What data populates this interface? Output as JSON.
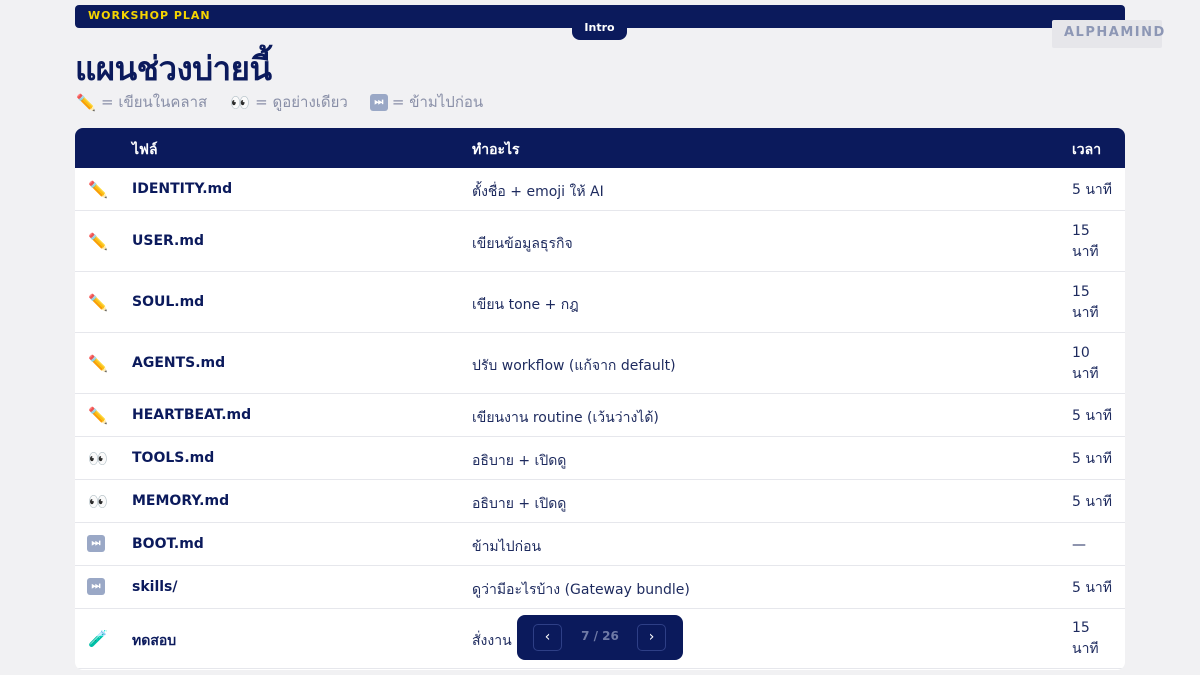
{
  "header": {
    "section_label": "WORKSHOP PLAN",
    "intro_tab": "Intro",
    "logo_text": "ALPHAMIND"
  },
  "title": "แผนช่วงบ่ายนี้",
  "legend": [
    {
      "icon": "pencil-icon",
      "glyph": "✏️",
      "text": "= เขียนในคลาส"
    },
    {
      "icon": "eyes-icon",
      "glyph": "👀",
      "text": "= ดูอย่างเดียว"
    },
    {
      "icon": "skip-icon",
      "glyph": "⏭",
      "text": "= ข้ามไปก่อน"
    }
  ],
  "table": {
    "headers": {
      "file": "ไฟล์",
      "what": "ทำอะไร",
      "time": "เวลา"
    },
    "rows": [
      {
        "icon": "pencil-icon",
        "file": "IDENTITY.md",
        "what": "ตั้งชื่อ + emoji ให้ AI",
        "time": "5 นาที"
      },
      {
        "icon": "pencil-icon",
        "file": "USER.md",
        "what": "เขียนข้อมูลธุรกิจ",
        "time": "15 นาที"
      },
      {
        "icon": "pencil-icon",
        "file": "SOUL.md",
        "what": "เขียน tone + กฎ",
        "time": "15 นาที"
      },
      {
        "icon": "pencil-icon",
        "file": "AGENTS.md",
        "what": "ปรับ workflow (แก้จาก default)",
        "time": "10 นาที"
      },
      {
        "icon": "pencil-icon",
        "file": "HEARTBEAT.md",
        "what": "เขียนงาน routine (เว้นว่างได้)",
        "time": "5 นาที"
      },
      {
        "icon": "eyes-icon",
        "file": "TOOLS.md",
        "what": "อธิบาย + เปิดดู",
        "time": "5 นาที"
      },
      {
        "icon": "eyes-icon",
        "file": "MEMORY.md",
        "what": "อธิบาย + เปิดดู",
        "time": "5 นาที"
      },
      {
        "icon": "skip-icon",
        "file": "BOOT.md",
        "what": "ข้ามไปก่อน",
        "time": "—"
      },
      {
        "icon": "skip-icon",
        "file": "skills/",
        "what": "ดูว่ามีอะไรบ้าง (Gateway bundle)",
        "time": "5 นาที"
      },
      {
        "icon": "test-tube-icon",
        "file": "ทดสอบ",
        "what": "สั่งงาน",
        "time": "15 นาที"
      }
    ]
  },
  "pager": {
    "prev": "‹",
    "next": "›",
    "status": "7 / 26"
  }
}
